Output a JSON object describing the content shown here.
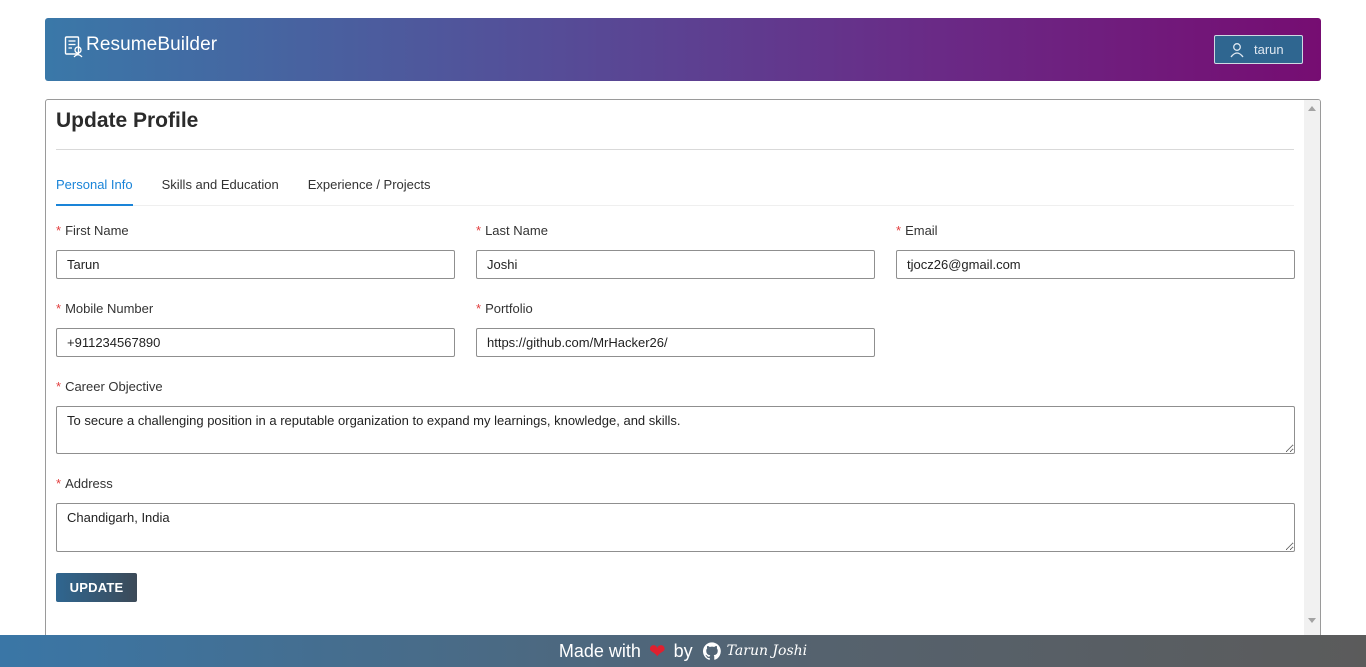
{
  "header": {
    "brand": "ResumeBuilder",
    "user_label": "tarun"
  },
  "page": {
    "title": "Update Profile"
  },
  "tabs": [
    {
      "label": "Personal Info",
      "active": true
    },
    {
      "label": "Skills and Education",
      "active": false
    },
    {
      "label": "Experience / Projects",
      "active": false
    }
  ],
  "form": {
    "required_mark": "*",
    "first_name": {
      "label": "First Name",
      "value": "Tarun"
    },
    "last_name": {
      "label": "Last Name",
      "value": "Joshi"
    },
    "email": {
      "label": "Email",
      "value": "tjocz26@gmail.com"
    },
    "mobile": {
      "label": "Mobile Number",
      "value": "+911234567890"
    },
    "portfolio": {
      "label": "Portfolio",
      "value": "https://github.com/MrHacker26/"
    },
    "career_objective": {
      "label": "Career Objective",
      "value": "To secure a challenging position in a reputable organization to expand my learnings, knowledge, and skills."
    },
    "address": {
      "label": "Address",
      "value": "Chandigarh, India"
    },
    "update_label": "UPDATE"
  },
  "footer": {
    "made_with": "Made with",
    "by": "by",
    "author": "Tarun Joshi",
    "heart_color": "#e0202f"
  },
  "colors": {
    "accent": "#1a84d8",
    "required": "#e23d3d",
    "header_start": "#3a78a8",
    "header_end": "#760d72"
  },
  "icons": {
    "brand": "resume-icon",
    "user": "user-icon",
    "footer_heart": "heart-icon",
    "footer_github": "github-icon"
  }
}
